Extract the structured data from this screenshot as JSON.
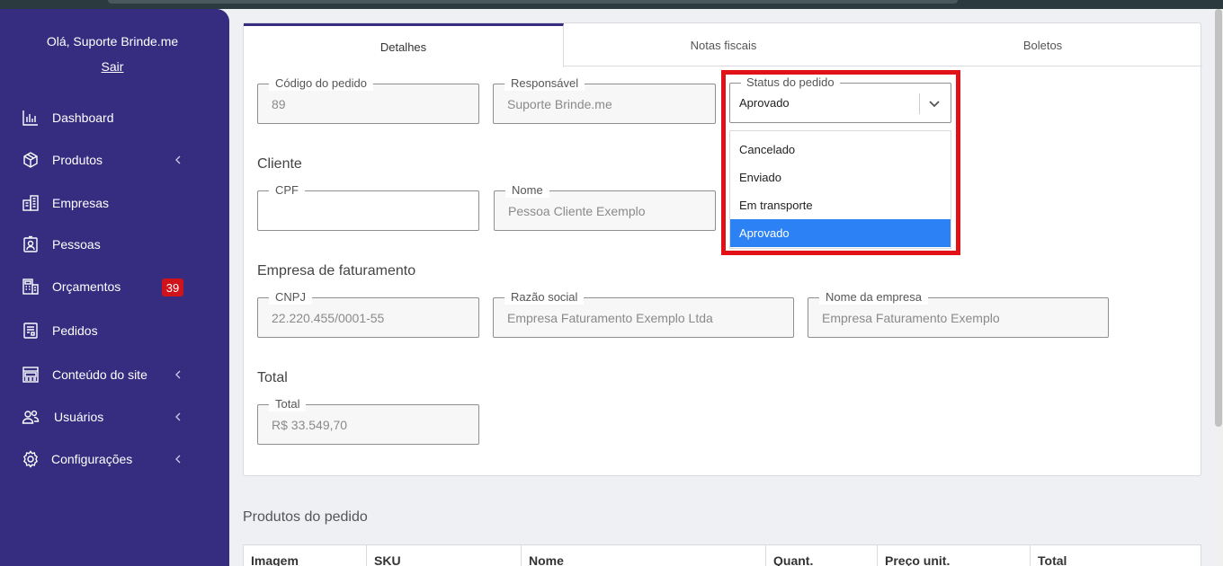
{
  "sidebar": {
    "greeting": "Olá, Suporte Brinde.me",
    "logout": "Sair",
    "items": [
      {
        "label": "Dashboard",
        "icon": "bar-chart-icon"
      },
      {
        "label": "Produtos",
        "icon": "box-icon"
      },
      {
        "label": "Empresas",
        "icon": "building-icon"
      },
      {
        "label": "Pessoas",
        "icon": "id-card-icon"
      },
      {
        "label": "Orçamentos",
        "icon": "calculator-icon",
        "badge": "39"
      },
      {
        "label": "Pedidos",
        "icon": "receipt-icon"
      },
      {
        "label": "Conteúdo do site",
        "icon": "layout-icon"
      },
      {
        "label": "Usuários",
        "icon": "users-icon"
      },
      {
        "label": "Configurações",
        "icon": "gear-icon"
      }
    ],
    "badge_color": "#d0121b",
    "background": "#362c80"
  },
  "tabs": [
    "Detalhes",
    "Notas fiscais",
    "Boletos"
  ],
  "order": {
    "code_label": "Código do pedido",
    "code_value": "89",
    "responsible_label": "Responsável",
    "responsible_value": "Suporte Brinde.me",
    "status_label": "Status do pedido",
    "status_value": "Aprovado",
    "status_options": [
      "Cancelado",
      "Enviado",
      "Em transporte",
      "Aprovado"
    ],
    "selected_color": "#2c82f5",
    "highlight_color": "#e01218"
  },
  "client": {
    "title": "Cliente",
    "cpf_label": "CPF",
    "cpf_value": "",
    "name_label": "Nome",
    "name_value": "Pessoa Cliente Exemplo"
  },
  "billing": {
    "title": "Empresa de faturamento",
    "cnpj_label": "CNPJ",
    "cnpj_value": "22.220.455/0001-55",
    "razao_label": "Razão social",
    "razao_value": "Empresa Faturamento Exemplo Ltda",
    "company_label": "Nome da empresa",
    "company_value": "Empresa Faturamento Exemplo"
  },
  "total": {
    "title": "Total",
    "label": "Total",
    "value": "R$ 33.549,70"
  },
  "products": {
    "title": "Produtos do pedido",
    "columns": [
      "Imagem",
      "SKU",
      "Nome",
      "Quant.",
      "Preço unit.",
      "Total"
    ]
  }
}
